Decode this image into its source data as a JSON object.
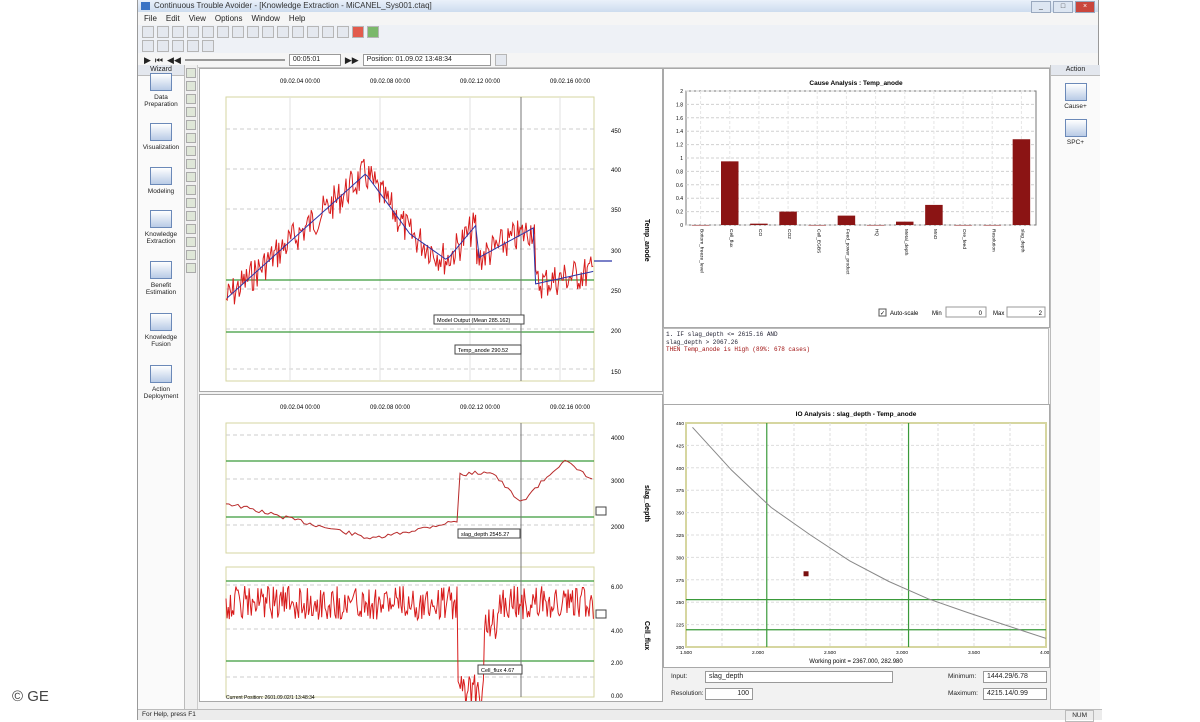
{
  "app": {
    "title": "Continuous Trouble Avoider - [Knowledge Extraction - MiCANEL_Sys001.ctaq]",
    "menu": [
      "File",
      "Edit",
      "View",
      "Options",
      "Window",
      "Help"
    ]
  },
  "nav": {
    "step_value": "00:05:01",
    "position_label": "Position: 01.09.02 13:48:34"
  },
  "left_sidebar": {
    "header": "Wizard",
    "items": [
      {
        "label": "Data Preparation"
      },
      {
        "label": "Visualization"
      },
      {
        "label": "Modeling"
      },
      {
        "label": "Knowledge Extraction"
      },
      {
        "label": "Benefit Estimation"
      },
      {
        "label": "Knowledge Fusion"
      },
      {
        "label": "Action Deployment"
      }
    ]
  },
  "right_sidebar": {
    "header": "Action",
    "items": [
      {
        "label": "Cause+"
      },
      {
        "label": "SPC+"
      }
    ]
  },
  "top_chart": {
    "x_ticks": [
      "09.02.04 00:00",
      "09.02.08 00:00",
      "09.02.12 00:00",
      "09.02.16 00:00"
    ],
    "y_ticks": [
      "450",
      "400",
      "350",
      "300",
      "250",
      "200",
      "150"
    ],
    "ylabel": "Temp_anode",
    "tag_model": "Model Output (Mean 285.162)",
    "tag_temp": "Temp_anode 290.52"
  },
  "bottom_chart": {
    "x_ticks": [
      "09.02.04 00:00",
      "09.02.08 00:00",
      "09.02.12 00:00",
      "09.02.16 00:00"
    ],
    "slag_ticks": [
      "4000",
      "3000",
      "2000"
    ],
    "slag_label": "slag_depth",
    "slag_tag": "slag_depth 2545.27",
    "cell_ticks": [
      "6.00",
      "4.00",
      "2.00",
      "0.00"
    ],
    "cell_label": "Cell_flux",
    "cell_tag": "Cell_flux 4.67",
    "current_position": "Current Position: 2601.09.02/1 13:48:34"
  },
  "cause_chart": {
    "title": "Cause Analysis : Temp_anode",
    "chart_data": {
      "type": "bar",
      "title": "Cause Analysis : Temp_anode",
      "categories": [
        "Bottom_freeze_level",
        "Cell_flux",
        "CO",
        "CO2",
        "Cell_EGBS",
        "Feed_power_product",
        "HQ",
        "Metal_depth",
        "MnO",
        "Ore_feed",
        "Resolution",
        "slag_depth"
      ],
      "values": [
        0,
        0.95,
        0.02,
        0.2,
        0,
        0.14,
        0,
        0.05,
        0.3,
        0,
        0,
        1.28
      ],
      "ylim": [
        0,
        2
      ],
      "y_ticks": [
        "2",
        "1.8",
        "1.6",
        "1.4",
        "1.2",
        "1",
        "0.8",
        "0.6",
        "0.4",
        "0.2",
        "0"
      ],
      "color": "#8b1414"
    },
    "automatic_label": "Auto-scale",
    "min_label": "Min",
    "min_value": "0",
    "max_label": "Max",
    "max_value": "2"
  },
  "rules": {
    "lines": [
      "1. IF slag_depth <= 2615.16 AND",
      "      slag_depth  > 2067.26",
      "   THEN Temp_anode is High (89%: 678 cases)"
    ]
  },
  "io_chart": {
    "title": "IO Analysis : slag_depth - Temp_anode",
    "chart_data": {
      "type": "line",
      "title": "IO Analysis : slag_depth - Temp_anode",
      "x": [
        1500,
        1800,
        2100,
        2400,
        2700,
        3000,
        3300,
        3600,
        3900,
        4200
      ],
      "y": [
        455,
        405,
        362,
        330,
        300,
        276,
        256,
        240,
        225,
        210
      ],
      "xlim": [
        1450,
        4200
      ],
      "ylim": [
        200,
        460
      ],
      "x_ticks": [
        "1.500",
        "2.000",
        "2.500",
        "3.000",
        "3.500",
        "4.000"
      ],
      "y_ticks": [
        "450",
        "425",
        "400",
        "375",
        "350",
        "325",
        "300",
        "275",
        "250",
        "225",
        "200"
      ],
      "working_point": [
        2367,
        285
      ]
    },
    "working_point_label": "Working point = 2367.000, 282.980",
    "input_label": "Input:",
    "input_value": "slag_depth",
    "resolution_label": "Resolution:",
    "resolution_value": "100",
    "minimum_label": "Minimum:",
    "minimum_value": "1444.29/6.78",
    "maximum_label": "Maximum:",
    "maximum_value": "4215.14/0.99"
  },
  "status": {
    "left": "For Help, press F1",
    "right": "NUM"
  },
  "copyright": "© GE"
}
